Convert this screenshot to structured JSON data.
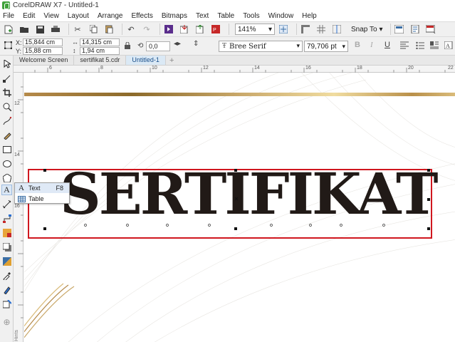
{
  "window": {
    "title": "CorelDRAW X7 - Untitled-1"
  },
  "menu": [
    "File",
    "Edit",
    "View",
    "Layout",
    "Arrange",
    "Effects",
    "Bitmaps",
    "Text",
    "Table",
    "Tools",
    "Window",
    "Help"
  ],
  "standard_toolbar": {
    "zoom": "141%",
    "snap_label": "Snap To"
  },
  "property_bar": {
    "x_label": "X:",
    "x_value": "15,844 cm",
    "y_label": "Y:",
    "y_value": "15,88 cm",
    "w_value": "14,315 cm",
    "h_value": "1,94 cm",
    "angle_value": "0,0",
    "font_name": "Bree Serif",
    "font_size": "79,706 pt"
  },
  "document_tabs": [
    "Welcome Screen",
    "sertifikat 5.cdr",
    "Untitled-1"
  ],
  "active_tab_index": 2,
  "rulers": {
    "horizontal": [
      "6",
      "8",
      "10",
      "12",
      "14",
      "16",
      "18",
      "20",
      "22"
    ],
    "vertical": [
      "12",
      "14",
      "16"
    ]
  },
  "canvas": {
    "heading_text": "SERTIFIKAT",
    "heading_color": "#211a17",
    "selection_color": "#d0171f",
    "gold_colors": [
      "#8c6a2a",
      "#e8d08e",
      "#b9904a"
    ]
  },
  "flyout": {
    "items": [
      {
        "label": "Text",
        "shortcut": "F8"
      },
      {
        "label": "Table",
        "shortcut": ""
      }
    ]
  },
  "toolbox_label": "Hints"
}
